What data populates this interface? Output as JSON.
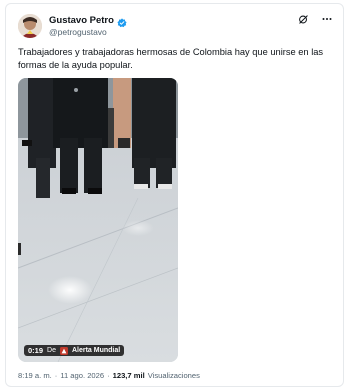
{
  "author": {
    "name": "Gustavo Petro",
    "handle": "@petrogustavo",
    "verified": true
  },
  "actions": {
    "grok_icon": "grok-icon",
    "more_icon": "more-icon"
  },
  "tweet": {
    "text": "Trabajadores y trabajadoras hermosas de Colombia hay que unirse en las formas de la ayuda popular."
  },
  "video": {
    "time": "0:19",
    "watermark_prefix": "De",
    "watermark_name": "Alerta Mundial"
  },
  "meta": {
    "time": "8:19 a. m.",
    "sep1": "·",
    "date": "11 ago. 2026",
    "sep2": "·",
    "views_count": "123,7 mil",
    "views_label": "Visualizaciones"
  },
  "colors": {
    "text": "#0f1419",
    "muted": "#536471",
    "verified_blue": "#1d9bf0",
    "border": "#e6e9ec"
  }
}
